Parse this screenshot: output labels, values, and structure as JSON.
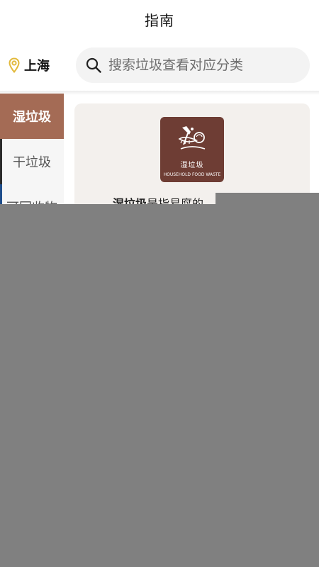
{
  "header": {
    "title": "指南"
  },
  "location": {
    "city": "上海",
    "icon": "location-pin-icon"
  },
  "search": {
    "placeholder": "搜索垃圾查看对应分类",
    "icon": "search-icon"
  },
  "categories": [
    {
      "label": "湿垃圾",
      "active": true,
      "accent": "#a46b55"
    },
    {
      "label": "干垃圾",
      "active": false,
      "accent": "#2b2b2b"
    },
    {
      "label": "可回收物",
      "active": false,
      "accent": "#1f4e8c"
    }
  ],
  "detail": {
    "logo": {
      "cn": "湿垃圾",
      "en": "HOUSEHOLD FOOD WASTE",
      "color": "#6e3d34"
    },
    "desc_bold": "湿垃圾",
    "desc_rest": "是指易腐的"
  },
  "colors": {
    "active_category_bg": "#a46b55",
    "overlay": "#808080",
    "card_bg": "#f3f0ed",
    "pin": "#e2b93b"
  }
}
